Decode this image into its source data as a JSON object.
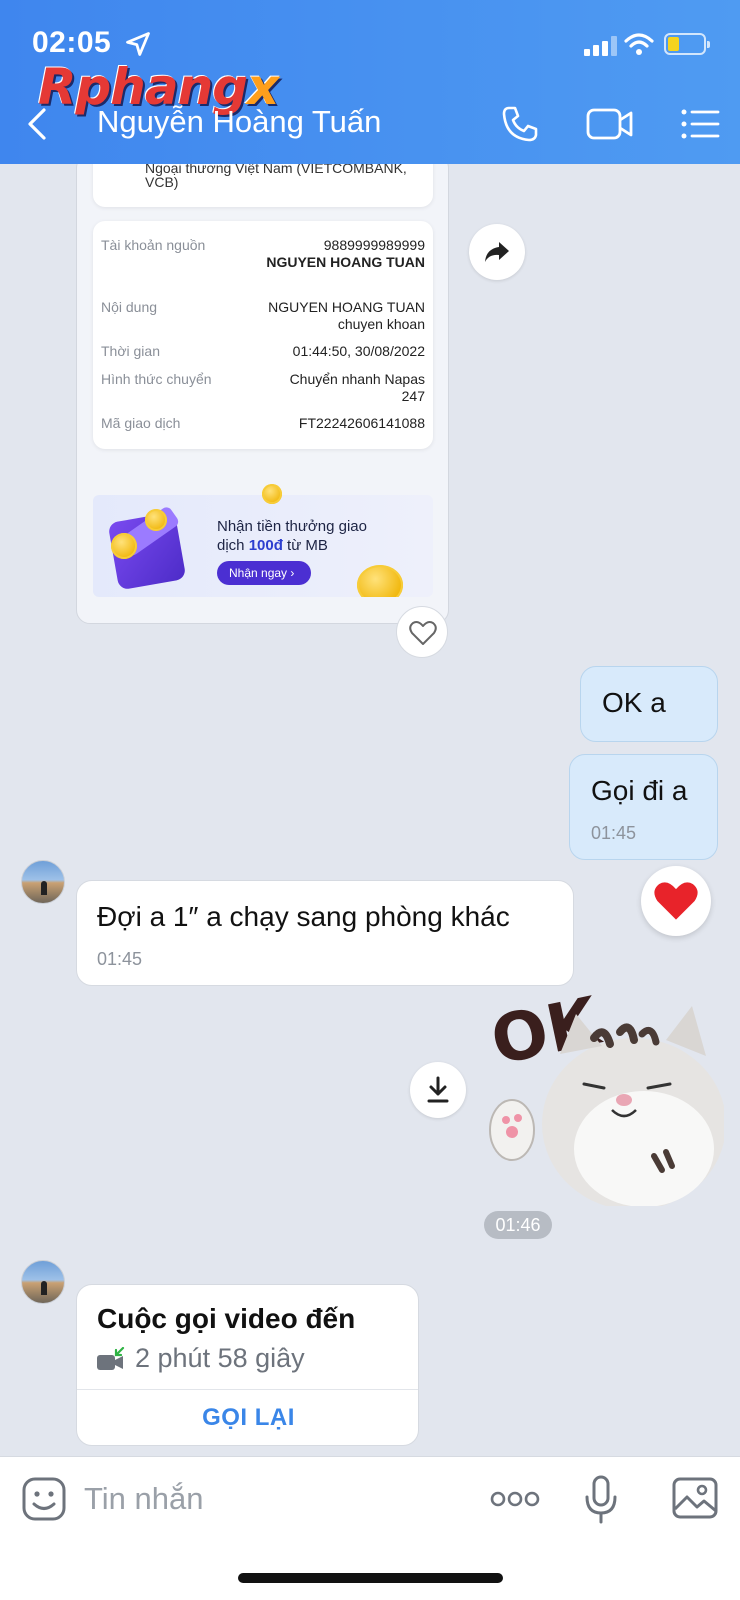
{
  "status_bar": {
    "time": "02:05"
  },
  "watermark": {
    "main": "Rphang",
    "accent": "x"
  },
  "header": {
    "contact_name": "Nguyễn Hoàng Tuấn"
  },
  "colors": {
    "header": "#4a92f0",
    "outgoing_bubble": "#d8eafb",
    "accent_blue": "#3a86e8",
    "promo_button": "#4b2fd2"
  },
  "receipt": {
    "bank_name": "Ngoại thương Việt Nam (VIETCOMBANK, VCB)",
    "rows": [
      {
        "label": "Tài khoản nguồn",
        "value": "9889999989999",
        "value2": "NGUYEN HOANG TUAN"
      },
      {
        "label": "Nội dung",
        "value": "NGUYEN HOANG TUAN chuyen khoan"
      },
      {
        "label": "Thời gian",
        "value": "01:44:50, 30/08/2022"
      },
      {
        "label": "Hình thức chuyển",
        "value": "Chuyển nhanh Napas 247"
      },
      {
        "label": "Mã giao dịch",
        "value": "FT22242606141088"
      }
    ],
    "promo": {
      "line1": "Nhận tiền thưởng giao",
      "line2_pre": "dịch ",
      "line2_bold": "100đ",
      "line2_post": " từ MB",
      "button": "Nhận ngay"
    }
  },
  "messages": [
    {
      "direction": "out",
      "text": "OK a"
    },
    {
      "direction": "out",
      "text": "Gọi đi a",
      "time": "01:45",
      "reaction": "heart"
    },
    {
      "direction": "in",
      "text": "Đợi a 1″ a chạy sang phòng khác",
      "time": "01:45"
    },
    {
      "direction": "out",
      "type": "sticker",
      "sticker_text": "OK",
      "time": "01:46"
    },
    {
      "direction": "in",
      "type": "call",
      "title": "Cuộc gọi video đến",
      "duration": "2 phút 58 giây",
      "action": "GỌI LẠI"
    }
  ],
  "input": {
    "placeholder": "Tin nhắn"
  },
  "icons": [
    "location-arrow-icon",
    "signal-icon",
    "wifi-icon",
    "battery-icon",
    "back-icon",
    "phone-icon",
    "video-camera-icon",
    "list-menu-icon",
    "share-icon",
    "heart-outline-icon",
    "heart-filled-icon",
    "download-icon",
    "incoming-video-icon",
    "emoji-icon",
    "more-icon",
    "microphone-icon",
    "image-icon"
  ]
}
